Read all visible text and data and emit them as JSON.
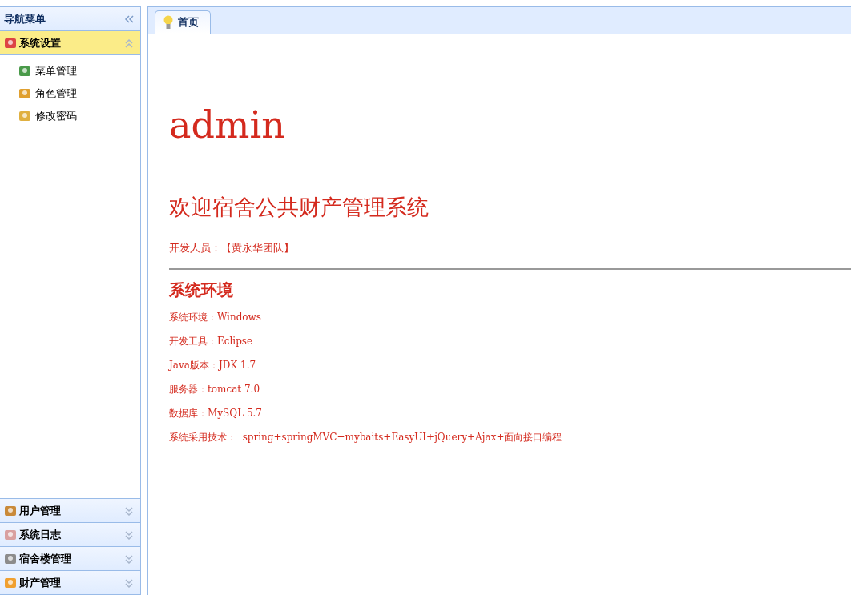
{
  "sidebar": {
    "title": "导航菜单",
    "sections": [
      {
        "label": "系统设置",
        "expanded": true,
        "items": [
          "菜单管理",
          "角色管理",
          "修改密码"
        ]
      },
      {
        "label": "用户管理",
        "expanded": false
      },
      {
        "label": "系统日志",
        "expanded": false
      },
      {
        "label": "宿舍楼管理",
        "expanded": false
      },
      {
        "label": "财产管理",
        "expanded": false
      }
    ]
  },
  "tabs": [
    {
      "label": "首页",
      "selected": true
    }
  ],
  "content": {
    "user": "admin",
    "welcome": "欢迎宿舍公共财产管理系统",
    "developer": "开发人员：【黄永华团队】",
    "env_heading": "系统环境",
    "env_lines": [
      "系统环境：Windows",
      "开发工具：Eclipse",
      "Java版本：JDK 1.7",
      "服务器：tomcat 7.0",
      "数据库：MySQL 5.7",
      "系统采用技术：  spring+springMVC+mybaits+EasyUI+jQuery+Ajax+面向接口编程"
    ]
  }
}
